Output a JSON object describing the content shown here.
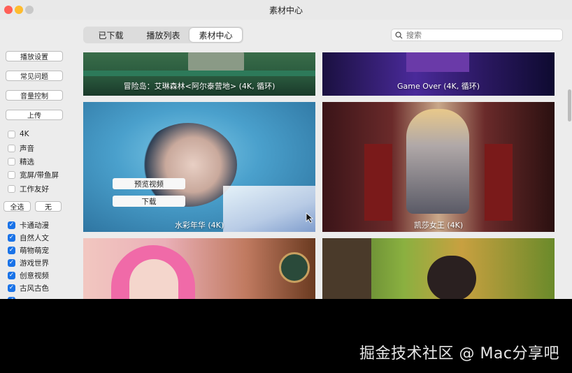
{
  "window": {
    "title": "素材中心"
  },
  "tabs": [
    {
      "label": "已下载"
    },
    {
      "label": "播放列表"
    },
    {
      "label": "素材中心"
    }
  ],
  "active_tab": "素材中心",
  "search": {
    "placeholder": "搜索",
    "value": ""
  },
  "sidebar": {
    "buttons": [
      "播放设置",
      "常见问题",
      "音量控制",
      "上传"
    ],
    "filters": [
      {
        "label": "4K",
        "checked": false
      },
      {
        "label": "声音",
        "checked": false
      },
      {
        "label": "精选",
        "checked": false
      },
      {
        "label": "宽屏/带鱼屏",
        "checked": false
      },
      {
        "label": "工作友好",
        "checked": false
      }
    ],
    "select_all_label": "全选",
    "select_none_label": "无",
    "categories": [
      {
        "label": "卡通动漫",
        "checked": true
      },
      {
        "label": "自然人文",
        "checked": true
      },
      {
        "label": "萌物萌宠",
        "checked": true
      },
      {
        "label": "游戏世界",
        "checked": true
      },
      {
        "label": "创意视频",
        "checked": true
      },
      {
        "label": "古风古色",
        "checked": true
      }
    ]
  },
  "cards": [
    {
      "caption": "冒险岛：艾琳森林<阿尔泰营地> (4K, 循环)"
    },
    {
      "caption": "Game Over (4K, 循环)"
    },
    {
      "caption": "水彩年华 (4K)",
      "hover_actions": [
        "预览视频",
        "下载"
      ]
    },
    {
      "caption": "凯莎女王 (4K)"
    },
    {
      "caption": ""
    },
    {
      "caption": ""
    }
  ],
  "watermark": "掘金技术社区 @ Mac分享吧",
  "colors": {
    "accent": "#1a73e8",
    "window_bg": "#ececec",
    "close": "#ff5f57",
    "minimize": "#febc2e"
  }
}
